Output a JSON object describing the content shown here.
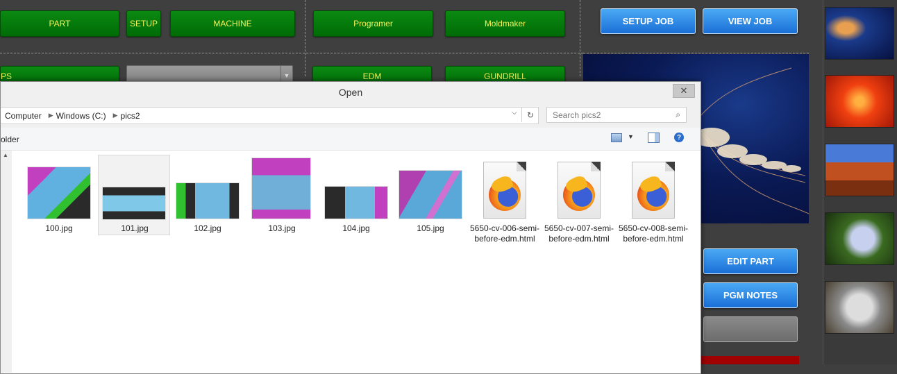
{
  "app": {
    "top_buttons": [
      "PART",
      "SETUP",
      "MACHINE",
      "Programer",
      "Moldmaker"
    ],
    "second_row_buttons": [
      "PS",
      "EDM",
      "GUNDRILL"
    ],
    "right_buttons": {
      "setup_job": "SETUP JOB",
      "view_job": "VIEW JOB",
      "edit_part": "EDIT PART",
      "pgm_notes": "PGM NOTES"
    }
  },
  "dialog": {
    "title": "Open",
    "close_glyph": "✕",
    "breadcrumb": [
      "Computer",
      "Windows (C:)",
      "pics2"
    ],
    "search_placeholder": "Search pics2",
    "left_toolbar_text": "older",
    "files": [
      {
        "name": "100.jpg",
        "kind": "image",
        "selected": false
      },
      {
        "name": "101.jpg",
        "kind": "image",
        "selected": true
      },
      {
        "name": "102.jpg",
        "kind": "image",
        "selected": false
      },
      {
        "name": "103.jpg",
        "kind": "image",
        "selected": false
      },
      {
        "name": "104.jpg",
        "kind": "image",
        "selected": false
      },
      {
        "name": "105.jpg",
        "kind": "image",
        "selected": false
      },
      {
        "name": "5650-cv-006-semi-before-edm.html",
        "kind": "firefox-html",
        "selected": false
      },
      {
        "name": "5650-cv-007-semi-before-edm.html",
        "kind": "firefox-html",
        "selected": false
      },
      {
        "name": "5650-cv-008-semi-before-edm.html",
        "kind": "firefox-html",
        "selected": false
      }
    ]
  },
  "colors": {
    "green_button": "#0b8a12",
    "green_text": "#f2f25a",
    "blue_button": "#1a6fd6",
    "background": "#3f3f3f"
  }
}
